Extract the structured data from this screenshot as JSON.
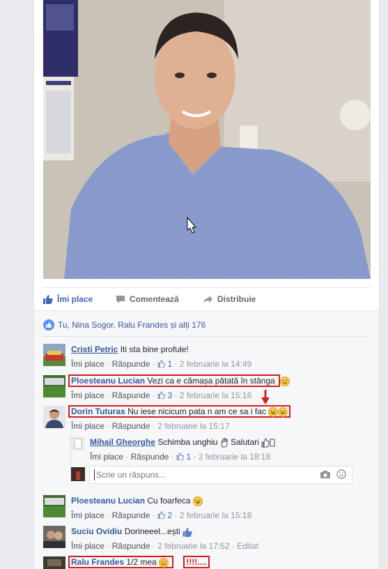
{
  "actions": {
    "like": "Îmi place",
    "comment": "Comentează",
    "share": "Distribuie"
  },
  "likes_summary": "Tu, Nina Sogor, Ralu Frandes și alți 176",
  "comments": [
    {
      "author": "Cristi Petric",
      "text": "Iti sta bine profule!",
      "like": "Îmi place",
      "reply": "Răspunde",
      "likes": "1",
      "date": "2 februarie la 14:49"
    },
    {
      "author": "Ploesteanu Lucian",
      "text": "Vezi ca e cămașa pătată în stânga",
      "like": "Îmi place",
      "reply": "Răspunde",
      "likes": "3",
      "date": "2 februarie la 15:16"
    },
    {
      "author": "Dorin Tuturas",
      "text": "Nu iese nicicum pata n am ce sa i fac",
      "like": "Îmi place",
      "reply": "Răspunde",
      "date": "2 februarie la 15:17"
    },
    {
      "author": "Mihail Gheorghe",
      "text": "Schimba unghiu",
      "text2": "Salutari",
      "like": "Îmi place",
      "reply": "Răspunde",
      "likes": "1",
      "date": "2 februarie la 18:18"
    },
    {
      "author": "Ploesteanu Lucian",
      "text": "Cu foarfeca",
      "like": "Îmi place",
      "reply": "Răspunde",
      "likes": "2",
      "date": "2 februarie la 15:18"
    },
    {
      "author": "Suciu Ovidiu",
      "text": "Dorineeel...ești",
      "like": "Îmi place",
      "reply": "Răspunde",
      "date": "2 februarie la 17:52",
      "edited": "Editat"
    },
    {
      "author": "Ralu Frandes",
      "text": "1/2 mea",
      "annotation": "!!!!...."
    }
  ],
  "reply_box": {
    "placeholder": "Scrie un răspuns..."
  },
  "colors": {
    "link_blue": "#365899",
    "like_blue": "#4267b2",
    "highlight_red": "#d11e1e"
  }
}
